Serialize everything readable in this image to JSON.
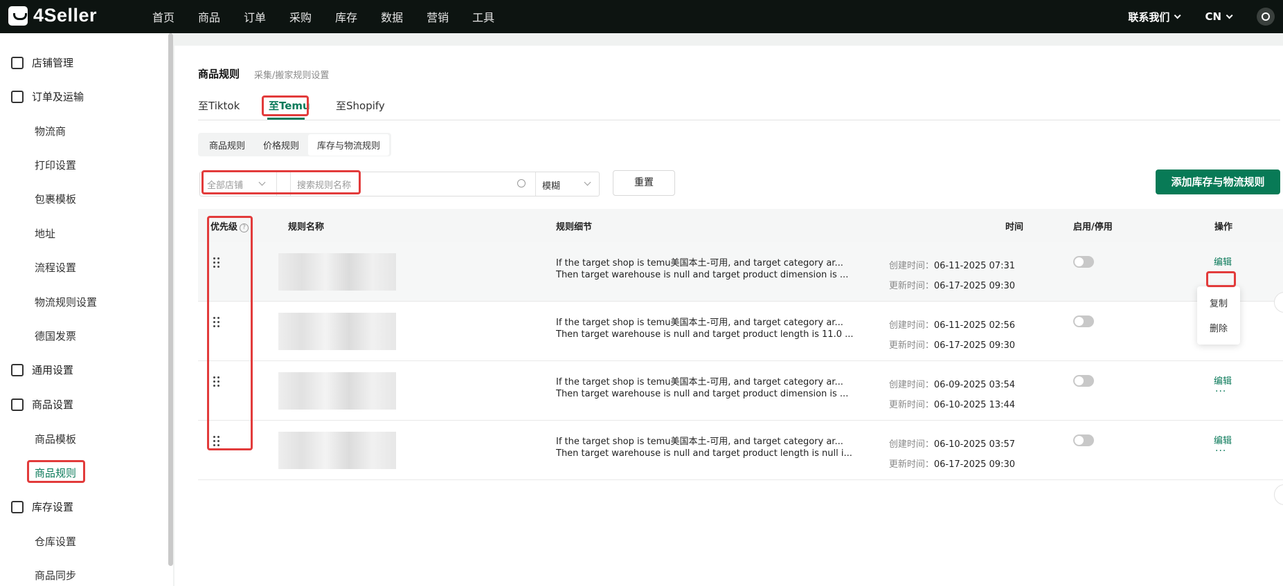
{
  "app": {
    "logo_text": "4Seller",
    "nav": [
      "首页",
      "商品",
      "订单",
      "采购",
      "库存",
      "数据",
      "营销",
      "工具"
    ],
    "contact_label": "联系我们",
    "lang_label": "CN"
  },
  "sidebar": {
    "store_mgmt": "店铺管理",
    "order_shipping": "订单及运输",
    "logistics": "物流商",
    "print_settings": "打印设置",
    "package_template": "包裹模板",
    "address": "地址",
    "flow_settings": "流程设置",
    "logistics_rules": "物流规则设置",
    "germany_invoice": "德国发票",
    "general_settings": "通用设置",
    "product_settings": "商品设置",
    "product_template": "商品模板",
    "product_rules": "商品规则",
    "inventory_settings": "库存设置",
    "warehouse_settings": "仓库设置",
    "product_sync": "商品同步"
  },
  "page": {
    "title": "商品规则",
    "subtitle": "采集/搬家规则设置",
    "tabs": [
      "至Tiktok",
      "至Temu",
      "至Shopify"
    ],
    "segments": [
      "商品规则",
      "价格规则",
      "库存与物流规则"
    ]
  },
  "filter": {
    "shop_placeholder": "全部店铺",
    "search_placeholder": "搜索规则名称",
    "mode": "模糊",
    "reset_label": "重置",
    "add_label": "添加库存与物流规则"
  },
  "table": {
    "headers": {
      "priority": "优先级",
      "name": "规则名称",
      "detail": "规则细节",
      "time": "时间",
      "status": "启用/停用",
      "action": "操作"
    },
    "created_label": "创建时间：",
    "updated_label": "更新时间：",
    "edit_label": "编辑",
    "more_label": "···",
    "rows": [
      {
        "detail1": "If the target shop is temu美国本土-可用, and target category ar...",
        "detail2": "Then target warehouse is null and target product dimension is ...",
        "created": "06-11-2025 07:31",
        "updated": "06-17-2025 09:30"
      },
      {
        "detail1": "If the target shop is temu美国本土-可用, and target category ar...",
        "detail2": "Then target warehouse is null and target product length is 11.0 ...",
        "created": "06-11-2025 02:56",
        "updated": "06-17-2025 09:30"
      },
      {
        "detail1": "If the target shop is temu美国本土-可用, and target category ar...",
        "detail2": "Then target warehouse is null and target product dimension is ...",
        "created": "06-09-2025 03:54",
        "updated": "06-10-2025 13:44"
      },
      {
        "detail1": "If the target shop is temu美国本土-可用, and target category ar...",
        "detail2": "Then target warehouse is null and target product length is null i...",
        "created": "06-10-2025 03:57",
        "updated": "06-17-2025 09:30"
      }
    ]
  },
  "dropdown": {
    "copy": "复制",
    "delete": "删除"
  },
  "colors": {
    "accent": "#087a56",
    "highlight": "#e23b3b",
    "topbar": "#0d1411"
  }
}
